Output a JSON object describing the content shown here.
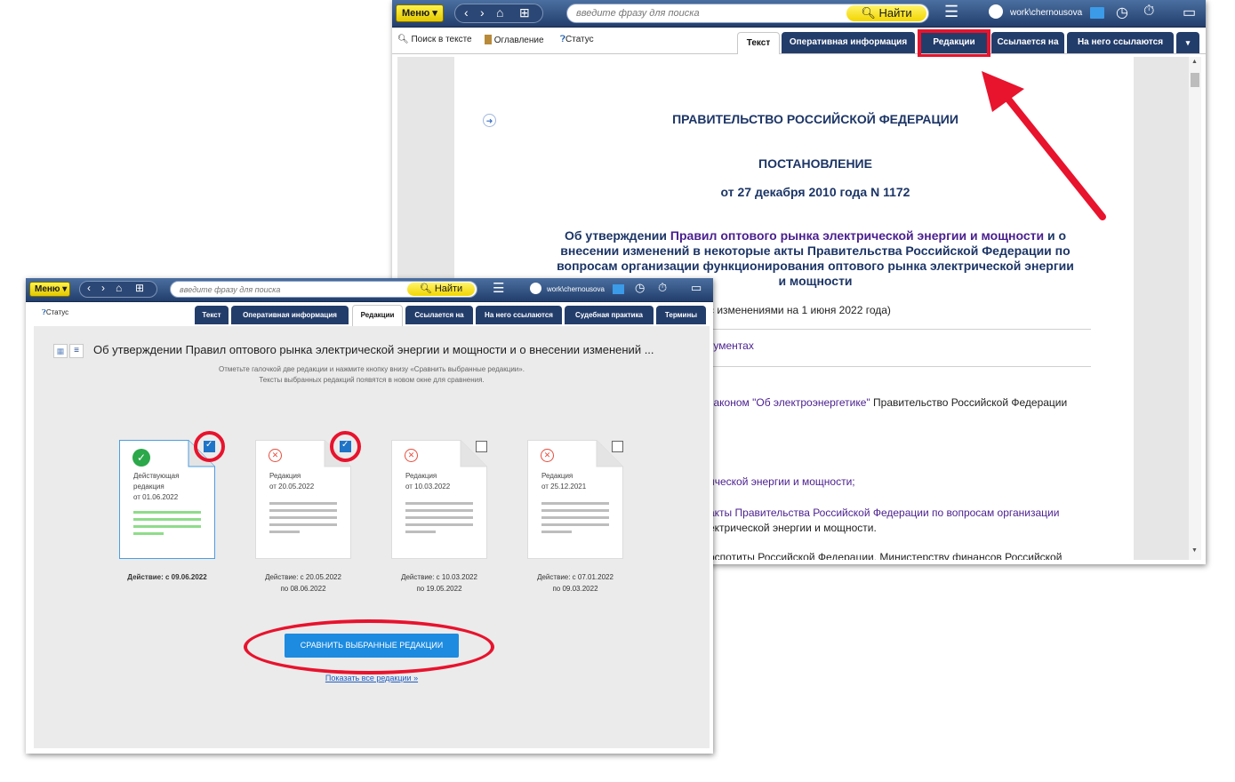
{
  "common": {
    "menu_label": "Меню ▾",
    "search_placeholder": "введите фразу для поиска",
    "find_label": "Найти",
    "user": "work\\chernousova",
    "status_label": "Статус"
  },
  "win1": {
    "tools": {
      "search_text": "Поиск в тексте",
      "contents": "Оглавление",
      "status": "Статус"
    },
    "tabs": [
      "Текст",
      "Оперативная информация",
      "Редакции",
      "Ссылается на",
      "На него ссылаются"
    ],
    "doc": {
      "gov": "ПРАВИТЕЛЬСТВО РОССИЙСКОЙ ФЕДЕРАЦИИ",
      "decree": "ПОСТАНОВЛЕНИЕ",
      "date": "от 27 декабря 2010 года N 1172",
      "title_pre": "Об утверждении ",
      "title_link": "Правил оптового рынка электрической энергии и мощности",
      "title_rest1": " и о",
      "title_line2": "внесении изменений в некоторые акты Правительства Российской Федерации по",
      "title_line3": "вопросам организации функционирования оптового рынка электрической энергии",
      "title_line4": "и мощности",
      "changes": "с изменениями на 1 июня 2022 года)",
      "docs_link": "кументах",
      "law_pre": "законом ",
      "law_link": "\"Об электроэнергетике\"",
      "law_rest": " Правительство Российской Федерации",
      "p1": "ической энергии и мощности;",
      "p2_link": "акты Правительства Российской Федерации по вопросам организации",
      "p2_line2": "ектрической энергии и мощности.",
      "p3": "рспотиты Российской Федерации, Министерству финансов Российской"
    }
  },
  "win2": {
    "tabs": [
      "Текст",
      "Оперативная информация",
      "Редакции",
      "Ссылается на",
      "На него ссылаются",
      "Судебная практика",
      "Термины"
    ],
    "title": "Об утверждении Правил оптового рынка электрической энергии и мощности и о внесении изменений ...",
    "hint1": "Отметьте галочкой две редакции и нажмите кнопку внизу «Сравнить выбранные редакции».",
    "hint2": "Тексты выбранных редакций появятся в новом окне для сравнения.",
    "cards": [
      {
        "l1": "Действующая",
        "l2": "редакция",
        "l3": "от 01.06.2022",
        "a1": "Действие: с 09.06.2022",
        "a2": ""
      },
      {
        "l1": "Редакция",
        "l2": "от 20.05.2022",
        "l3": "",
        "a1": "Действие: с 20.05.2022",
        "a2": "по 08.06.2022"
      },
      {
        "l1": "Редакция",
        "l2": "от 10.03.2022",
        "l3": "",
        "a1": "Действие: с 10.03.2022",
        "a2": "по 19.05.2022"
      },
      {
        "l1": "Редакция",
        "l2": "от 25.12.2021",
        "l3": "",
        "a1": "Действие: с 07.01.2022",
        "a2": "по 09.03.2022"
      }
    ],
    "compare_label": "СРАВНИТЬ ВЫБРАННЫЕ РЕДАКЦИИ",
    "show_all": "Показать все редакции »"
  },
  "colors": {
    "highlight_red": "#e8132d",
    "primary_blue": "#1c8be0",
    "nav_navy": "#233d6b"
  }
}
